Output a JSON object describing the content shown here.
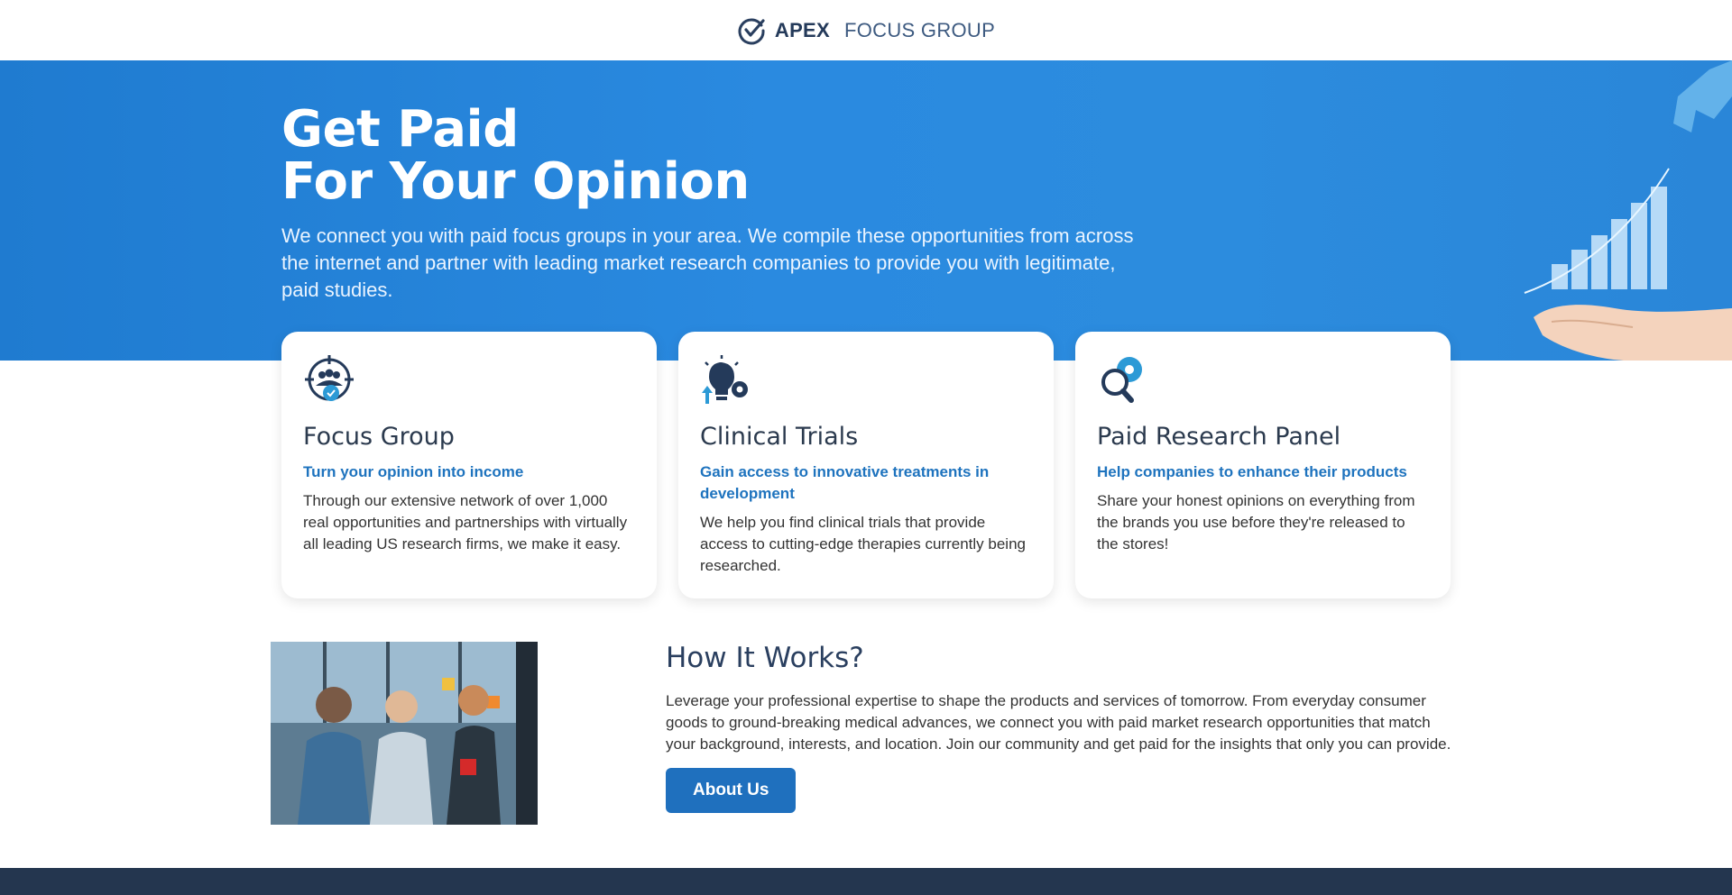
{
  "header": {
    "logo_strong": "APEX",
    "logo_light": "FOCUS GROUP",
    "logo_icon": "check-circle-icon"
  },
  "hero": {
    "title_line1": "Get Paid",
    "title_line2": "For Your Opinion",
    "description": "We connect you with paid focus groups in your area. We compile these opportunities from across the internet and partner with leading market research companies to provide you with legitimate, paid studies."
  },
  "cards": [
    {
      "icon": "target-group-icon",
      "title": "Focus Group",
      "subtitle": "Turn your opinion into income",
      "text": "Through our extensive network of over 1,000 real opportunities and partnerships with virtually all leading US research firms, we make it easy."
    },
    {
      "icon": "lightbulb-gear-icon",
      "title": "Clinical Trials",
      "subtitle": "Gain access to innovative treatments in development",
      "text": "We help you find clinical trials that provide access to cutting-edge therapies currently being researched."
    },
    {
      "icon": "search-gear-icon",
      "title": "Paid Research Panel",
      "subtitle": "Help companies to enhance their products",
      "text": "Share your honest opinions on everything from the brands you use before they're released to the stores!"
    }
  ],
  "how": {
    "title": "How It Works?",
    "text": "Leverage your professional expertise to shape the products and services of tomorrow. From everyday consumer goods to ground-breaking medical advances, we connect you with paid market research opportunities that match your background, interests, and location. Join our community and get paid for the insights that only you can provide.",
    "button_label": "About Us"
  },
  "colors": {
    "brand_blue": "#1f70be",
    "hero_blue": "#2a8ae0",
    "footer_navy": "#24364f"
  }
}
